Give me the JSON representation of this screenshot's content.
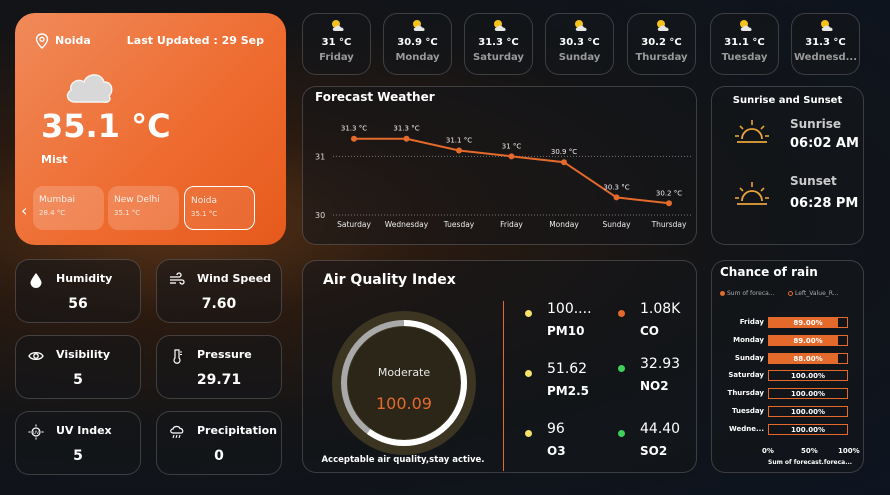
{
  "current": {
    "location": "Noida",
    "last_updated": "Last Updated : 29 Sep",
    "temperature": "35.1 °C",
    "condition": "Mist"
  },
  "cities": [
    {
      "name": "Mumbai",
      "temp": "28.4 °C"
    },
    {
      "name": "New Delhi",
      "temp": "35.1 °C"
    },
    {
      "name": "Noida",
      "temp": "35.1 °C"
    }
  ],
  "days": [
    {
      "temp": "31 °C",
      "day": "Friday"
    },
    {
      "temp": "30.9 °C",
      "day": "Monday"
    },
    {
      "temp": "31.3 °C",
      "day": "Saturday"
    },
    {
      "temp": "30.3 °C",
      "day": "Sunday"
    },
    {
      "temp": "30.2 °C",
      "day": "Thursday"
    },
    {
      "temp": "31.1 °C",
      "day": "Tuesday"
    },
    {
      "temp": "31.3 °C",
      "day": "Wednesd..."
    }
  ],
  "forecast": {
    "title": "Forecast Weather"
  },
  "chart_data": [
    {
      "type": "line",
      "title": "Forecast Weather",
      "categories": [
        "Saturday",
        "Wednesday",
        "Tuesday",
        "Friday",
        "Monday",
        "Sunday",
        "Thursday"
      ],
      "values": [
        31.3,
        31.3,
        31.1,
        31.0,
        30.9,
        30.3,
        30.2
      ],
      "labels": [
        "31.3 °C",
        "31.3 °C",
        "31.1 °C",
        "31 °C",
        "30.9 °C",
        "30.3 °C",
        "30.2 °C"
      ],
      "yticks": [
        "31",
        "30"
      ],
      "ylim": [
        30.0,
        31.5
      ],
      "color": "#e46a2c"
    },
    {
      "type": "bar",
      "title": "Chance of rain",
      "categories": [
        "Friday",
        "Monday",
        "Sunday",
        "Saturday",
        "Thursday",
        "Tuesday",
        "Wedne..."
      ],
      "values": [
        89,
        89,
        88,
        100,
        100,
        100,
        100
      ],
      "labels": [
        "89.00%",
        "89.00%",
        "88.00%",
        "100.00%",
        "100.00%",
        "100.00%",
        "100.00%"
      ],
      "legend": [
        "Sum of foreca...",
        "Left_Value_R..."
      ],
      "xticks": [
        "0%",
        "50%",
        "100%"
      ],
      "xlabel": "Sum of forecast.foreca...",
      "xlim": [
        0,
        100
      ],
      "color": "#e46a2c"
    }
  ],
  "sun": {
    "title": "Sunrise and Sunset",
    "sunrise_label": "Sunrise",
    "sunrise_time": "06:02 AM",
    "sunset_label": "Sunset",
    "sunset_time": "06:28 PM"
  },
  "metrics": {
    "humidity": {
      "label": "Humidity",
      "value": "56"
    },
    "wind": {
      "label": "Wind Speed",
      "value": "7.60"
    },
    "visibility": {
      "label": "Visibility",
      "value": "5"
    },
    "pressure": {
      "label": "Pressure",
      "value": "29.71"
    },
    "uv": {
      "label": "UV Index",
      "value": "5"
    },
    "precip": {
      "label": "Precipitation",
      "value": "0"
    }
  },
  "aqi": {
    "title": "Air Quality Index",
    "level": "Moderate",
    "value": "100.09",
    "gauge_fraction": 0.6,
    "note": "Acceptable air quality,stay active.",
    "pollutants": [
      {
        "value": "100....",
        "name": "PM10",
        "color": "#f5e26a"
      },
      {
        "value": "1.08K",
        "name": "CO",
        "color": "#e46a2c"
      },
      {
        "value": "51.62",
        "name": "PM2.5",
        "color": "#f5e26a"
      },
      {
        "value": "32.93",
        "name": "NO2",
        "color": "#3fd05a"
      },
      {
        "value": "96",
        "name": "O3",
        "color": "#f5e26a"
      },
      {
        "value": "44.40",
        "name": "SO2",
        "color": "#3fd05a"
      }
    ]
  },
  "rain": {
    "title": "Chance of rain"
  },
  "colors": {
    "accent": "#e46a2c",
    "card_orange": "#ee6a2e"
  }
}
